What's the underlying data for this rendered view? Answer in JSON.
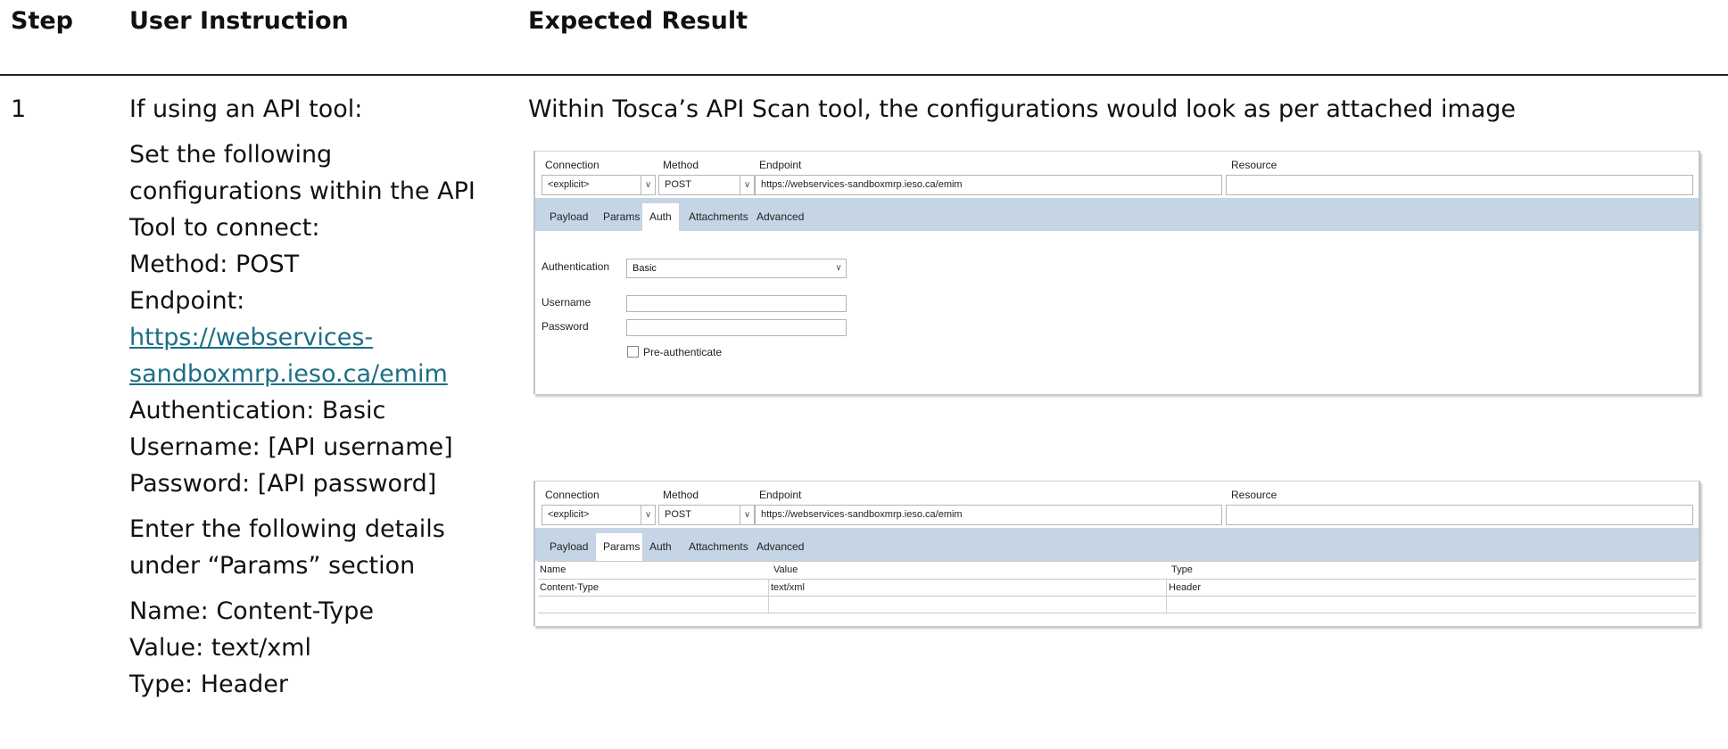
{
  "headers": {
    "step": "Step",
    "instruction": "User Instruction",
    "expected": "Expected Result"
  },
  "row": {
    "step": "1",
    "instruction": {
      "intro": "If using an API tool:",
      "set_lines": [
        "Set the following",
        "configurations within the API",
        "Tool to connect:",
        "Method: POST",
        "Endpoint:"
      ],
      "endpoint_link_lines": [
        "https://webservices-",
        "sandboxmrp.ieso.ca/emim"
      ],
      "auth_lines": [
        "Authentication: Basic",
        "Username: [API username]",
        "Password: [API password]"
      ],
      "params_lines": [
        "Enter the following details",
        "under “Params” section"
      ],
      "param_values": [
        "Name: Content-Type",
        "Value: text/xml",
        "Type: Header"
      ]
    },
    "expected": "Within Tosca’s API Scan tool, the configurations would look as per attached image"
  },
  "tosca": {
    "labels": {
      "connection": "Connection",
      "method": "Method",
      "endpoint": "Endpoint",
      "resource": "Resource"
    },
    "connection_value": "<explicit>",
    "method_value": "POST",
    "endpoint_value": "https://webservices-sandboxmrp.ieso.ca/emim",
    "tabs": [
      "Payload",
      "Params",
      "Auth",
      "Attachments",
      "Advanced"
    ],
    "auth": {
      "authentication_label": "Authentication",
      "authentication_value": "Basic",
      "username_label": "Username",
      "password_label": "Password",
      "preauth_label": "Pre-authenticate"
    },
    "params": {
      "columns": [
        "Name",
        "Value",
        "Type"
      ],
      "rows": [
        [
          "Content-Type",
          "text/xml",
          "Header"
        ]
      ]
    }
  }
}
